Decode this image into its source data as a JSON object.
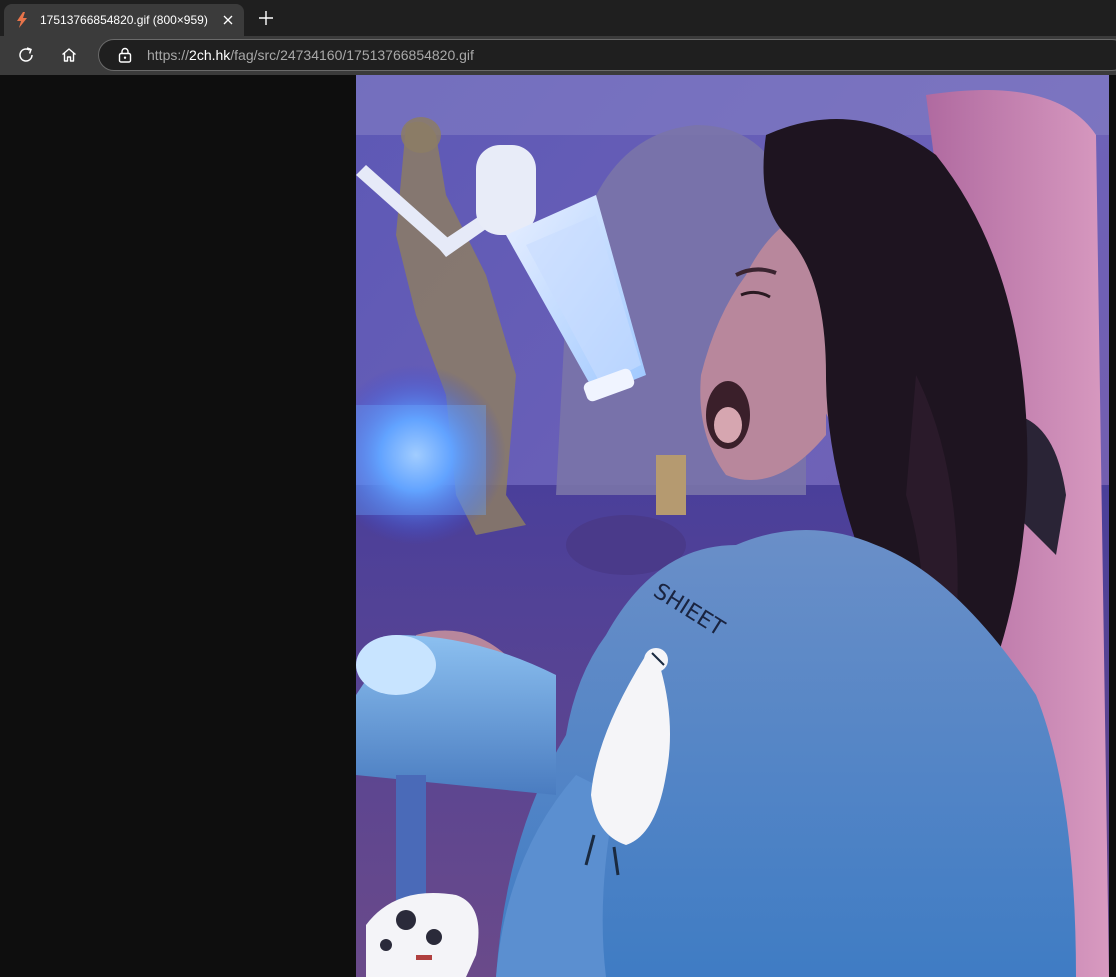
{
  "tab": {
    "title": "17513766854820.gif (800×959)",
    "favicon": "lightning-icon"
  },
  "toolbar": {
    "reload_icon": "reload-icon",
    "home_icon": "home-icon"
  },
  "address": {
    "scheme": "https://",
    "host": "2ch.hk",
    "path": "/fag/src/24734160/17513766854820.gif",
    "lock_icon": "lock-icon"
  },
  "image": {
    "sweater_text": "SHIEET",
    "colors": {
      "wall": "#6a62b0",
      "chair": "#c77aa8",
      "sweater": "#4e87c4",
      "hair": "#1e1420",
      "skin": "#b8879c",
      "mic": "#d8e4ff",
      "desk": "#6ea6d8"
    }
  }
}
